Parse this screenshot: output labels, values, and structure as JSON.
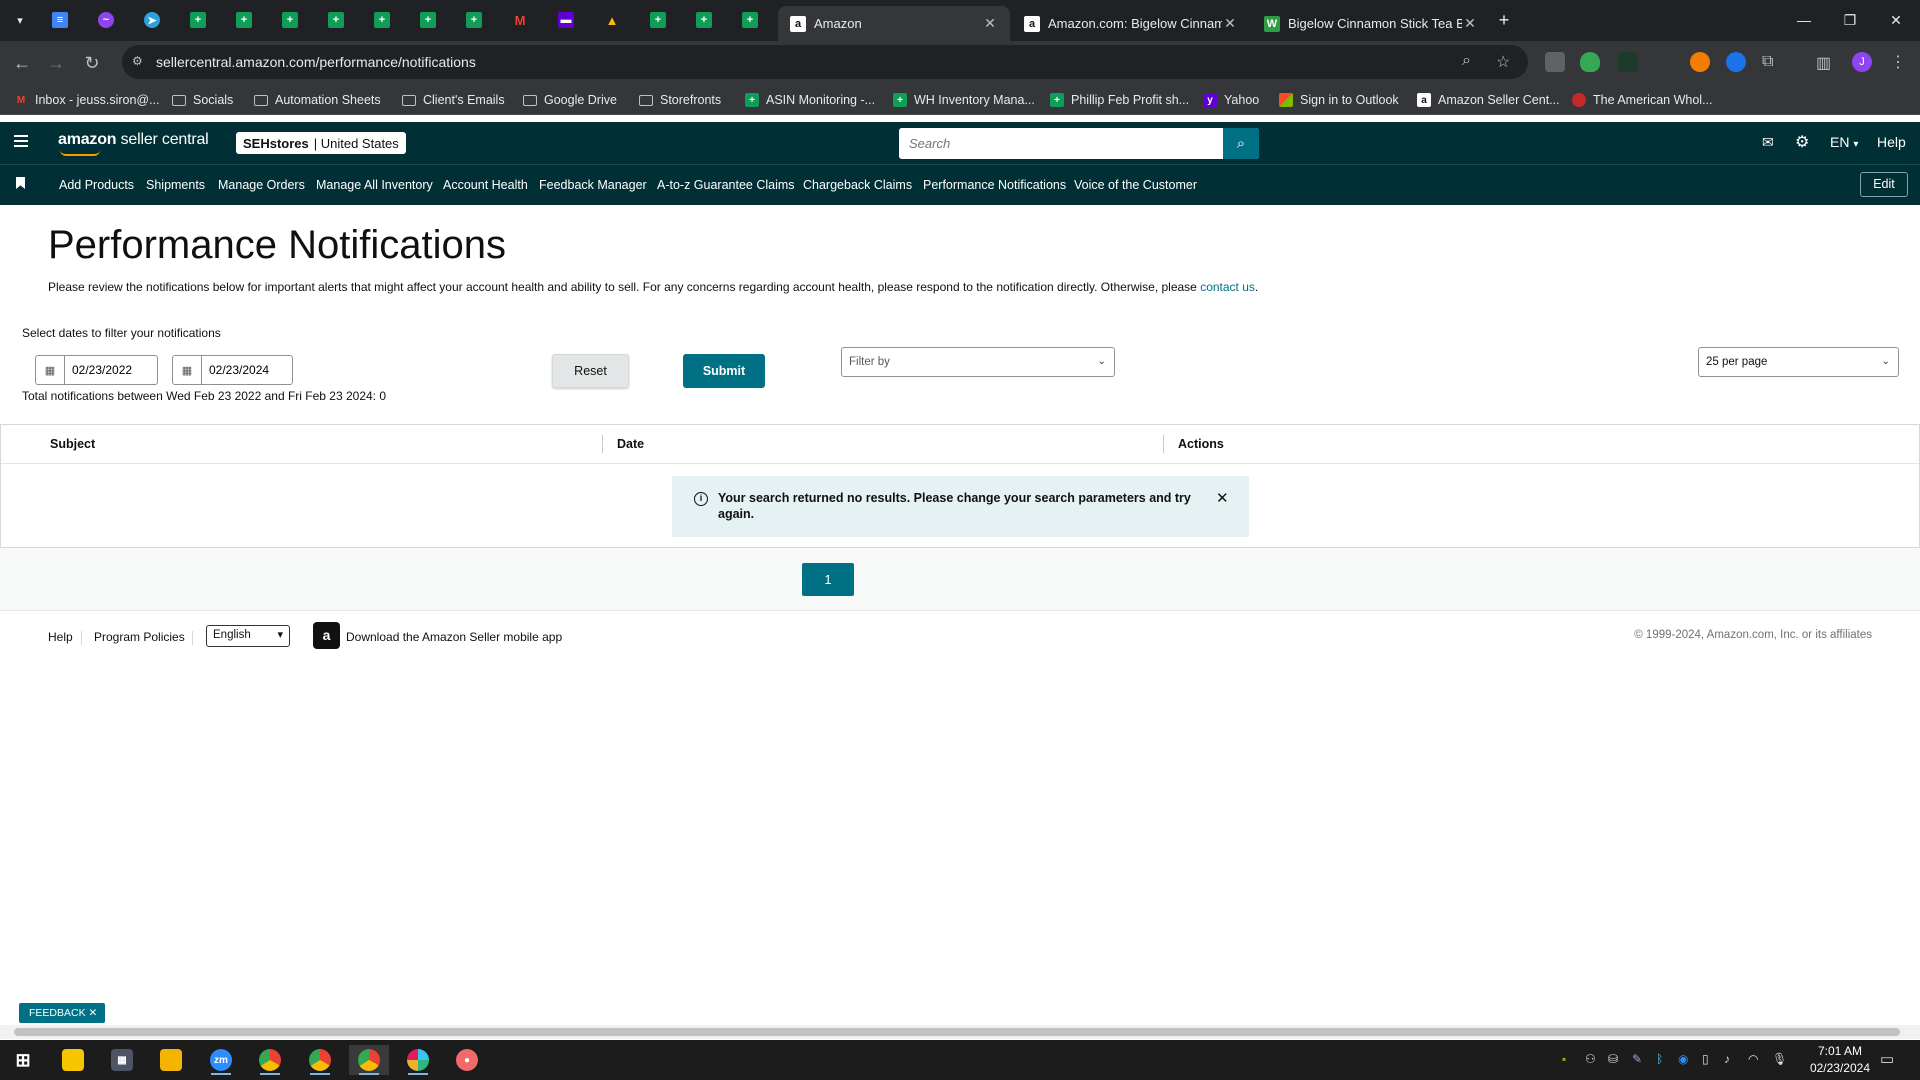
{
  "browser": {
    "tabs": [
      {
        "label": "Amazon",
        "active": true
      },
      {
        "label": "Amazon.com: Bigelow Cinnamo",
        "active": false
      },
      {
        "label": "Bigelow Cinnamon Stick Tea Ba",
        "active": false
      }
    ],
    "url": "sellercentral.amazon.com/performance/notifications",
    "bookmarks": [
      {
        "label": "Inbox - jeuss.siron@..."
      },
      {
        "label": "Socials"
      },
      {
        "label": "Automation Sheets"
      },
      {
        "label": "Client's Emails"
      },
      {
        "label": "Google Drive"
      },
      {
        "label": "Storefronts"
      },
      {
        "label": "ASIN Monitoring -..."
      },
      {
        "label": "WH Inventory Mana..."
      },
      {
        "label": "Phillip Feb Profit sh..."
      },
      {
        "label": "Yahoo"
      },
      {
        "label": "Sign in to Outlook"
      },
      {
        "label": "Amazon Seller Cent..."
      },
      {
        "label": "The American Whol..."
      }
    ],
    "profile_initial": "J"
  },
  "header": {
    "logo_bold": "amazon",
    "logo_text": " seller central",
    "store_name": "SEHstores",
    "store_region": "| United States",
    "search_placeholder": "Search",
    "language": "EN",
    "help": "Help"
  },
  "nav": {
    "items": [
      "Add Products",
      "Shipments",
      "Manage Orders",
      "Manage All Inventory",
      "Account Health",
      "Feedback Manager",
      "A-to-z Guarantee Claims",
      "Chargeback Claims",
      "Performance Notifications",
      "Voice of the Customer"
    ],
    "edit": "Edit"
  },
  "main": {
    "title": "Performance Notifications",
    "description": "Please review the notifications below for important alerts that might affect your account health and ability to sell. For any concerns regarding account health, please respond to the notification directly. Otherwise, please ",
    "contact_link": "contact us",
    "description_end": ".",
    "filter_label": "Select dates to filter your notifications",
    "start_date": "02/23/2022",
    "end_date": "02/23/2024",
    "total_text": "Total notifications between Wed Feb 23 2022 and Fri Feb 23 2024: 0",
    "reset": "Reset",
    "submit": "Submit",
    "filter_placeholder": "Filter by",
    "per_page": "25 per page",
    "columns": [
      "Subject",
      "Date",
      "Actions"
    ],
    "alert_message": "Your search returned no results. Please change your search parameters and try again.",
    "current_page": "1"
  },
  "footer": {
    "help": "Help",
    "program_policies": "Program Policies",
    "language": "English",
    "app_download": "Download the Amazon Seller mobile app",
    "copyright": "© 1999-2024, Amazon.com, Inc. or its affiliates"
  },
  "feedback": "FEEDBACK",
  "taskbar": {
    "time": "7:01 AM",
    "date": "02/23/2024"
  },
  "colors": {
    "header_bg": "#002f36",
    "accent": "#007185",
    "alert_bg": "#e6f1f4"
  }
}
